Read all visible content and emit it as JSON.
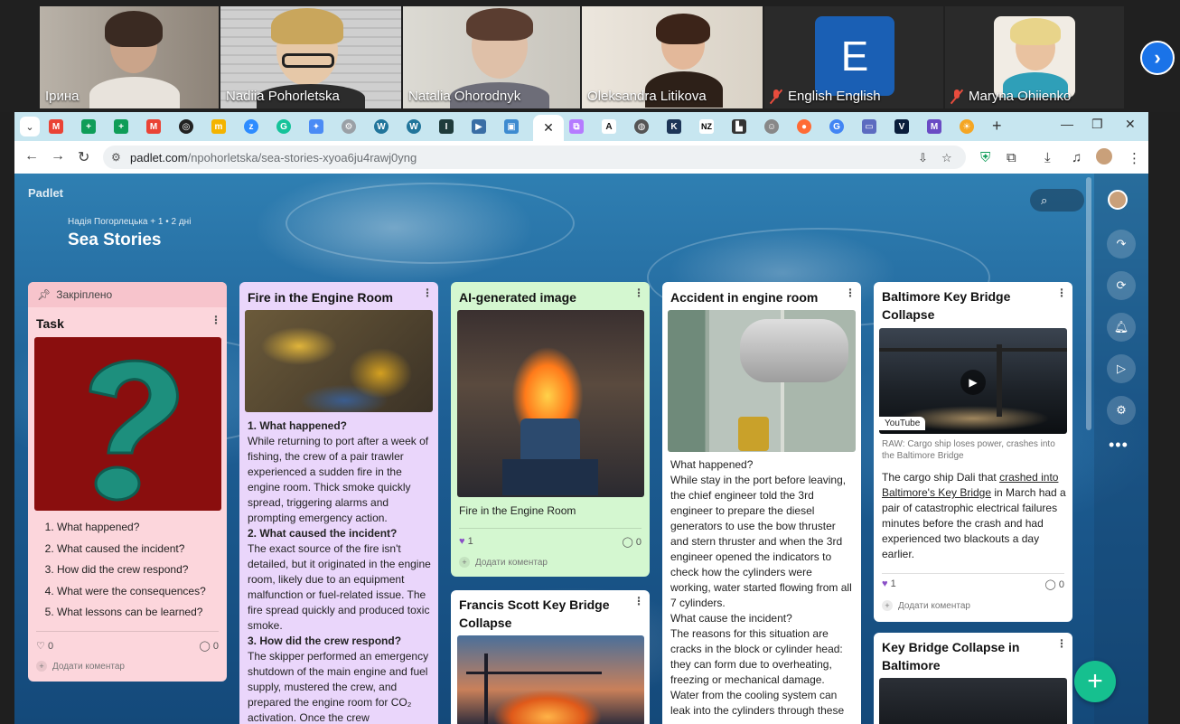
{
  "meeting": {
    "participants": [
      {
        "name": "Ірина",
        "muted": false
      },
      {
        "name": "Nadiia Pohorletska",
        "muted": false
      },
      {
        "name": "Natalia Ohorodnyk",
        "muted": false
      },
      {
        "name": "Oleksandra Litikova",
        "muted": false
      },
      {
        "name": "English English",
        "muted": true,
        "initial": "E"
      },
      {
        "name": "Maryna Ohiienko",
        "muted": true
      }
    ],
    "next_icon": "chevron-right-icon"
  },
  "browser": {
    "active_tab_close": "✕",
    "new_tab": "+",
    "url_host": "padlet.com",
    "url_path": "/npohorletska/sea-stories-xyoa6ju4rawj0yng"
  },
  "padlet": {
    "logo": "Padlet",
    "meta": "Надія Погорлецька + 1 • 2 дні",
    "title": "Sea Stories",
    "add_comment": "Додати коментар"
  },
  "cards": {
    "task": {
      "pinned_label": "Закріплено",
      "title": "Task",
      "questions": [
        "What happened?",
        "What caused the incident?",
        "How did the crew respond?",
        "What were the consequences?",
        "What lessons can be learned?"
      ],
      "likes": "0",
      "comments": "0"
    },
    "fire": {
      "title": "Fire in the Engine Room",
      "h1": "1. What happened?",
      "p1": "While returning to port after a week of fishing, the crew of a pair trawler experienced a sudden fire in the engine room. Thick smoke quickly spread, triggering alarms and prompting emergency action.",
      "h2": "2. What caused the incident?",
      "p2": "The exact source of the fire isn't detailed, but it originated in the engine room, likely due to an equipment malfunction or fuel-related issue. The fire spread quickly and produced toxic smoke.",
      "h3": "3. How did the crew respond?",
      "p3": "The skipper performed an emergency shutdown of the main engine and fuel supply, mustered the crew, and prepared the engine room for CO₂ activation. Once the crew"
    },
    "ai": {
      "title": "AI-generated image",
      "caption": "Fire in the Engine Room",
      "likes": "1",
      "comments": "0"
    },
    "fsk": {
      "title": "Francis Scott Key Bridge Collapse"
    },
    "accident": {
      "title": "Accident in engine room",
      "text": "What happened?\nWhile stay in the port before leaving, the chief engineer told the 3rd engineer to prepare the diesel generators to use the bow thruster and stern thruster and when the 3rd engineer opened the indicators to check how the cylinders were working, water started flowing from all 7 cylinders.\nWhat cause the incident?\nThe reasons for this situation are cracks in the block or cylinder head: they can form due to overheating, freezing or mechanical damage. Water from the cooling system can leak into the cylinders through these"
    },
    "baltimore": {
      "title": "Baltimore Key Bridge Collapse",
      "source": "YouTube",
      "video_title": "RAW: Cargo ship loses power, crashes into the Baltimore Bridge",
      "text_before": "The cargo ship Dali that ",
      "text_link": "crashed into Baltimore's Key Bridge",
      "text_after": " in March had a pair of catastrophic electrical failures minutes before the crash and had experienced two blackouts a day earlier.",
      "likes": "1",
      "comments": "0"
    },
    "keybridge": {
      "title": "Key Bridge Collapse in Baltimore"
    }
  },
  "colors": {
    "pink": "#fcd6dc",
    "lavender": "#ead6fb",
    "mint": "#d4f7d0",
    "white": "#ffffff",
    "fab": "#16c08f"
  }
}
